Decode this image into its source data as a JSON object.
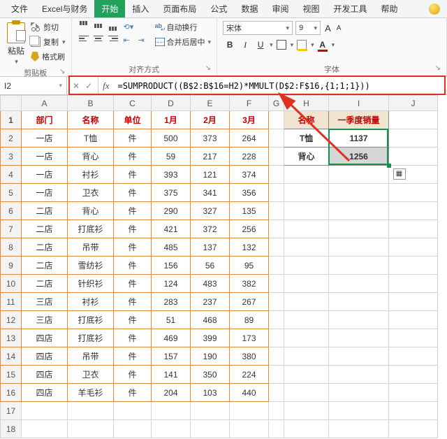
{
  "menu": {
    "items": [
      "文件",
      "Excel与财务",
      "开始",
      "插入",
      "页面布局",
      "公式",
      "数据",
      "审阅",
      "视图",
      "开发工具",
      "帮助"
    ],
    "active_index": 2
  },
  "ribbon": {
    "clipboard": {
      "paste": "粘贴",
      "cut": "剪切",
      "copy": "复制",
      "brush": "格式刷",
      "label": "剪贴板"
    },
    "align": {
      "wrap": "自动换行",
      "merge": "合并后居中",
      "label": "对齐方式"
    },
    "font": {
      "name": "宋体",
      "size": "9",
      "grow": "A",
      "shrink": "A",
      "bold": "B",
      "italic": "I",
      "underline": "U",
      "label": "字体"
    }
  },
  "namebox": "I2",
  "formula": "=SUMPRODUCT((B$2:B$16=H2)*MMULT(D$2:F$16,{1;1;1}))",
  "headers_main": [
    "部门",
    "名称",
    "单位",
    "1月",
    "2月",
    "3月"
  ],
  "headers_side": [
    "名称",
    "一季度销量"
  ],
  "rows": [
    [
      "一店",
      "T恤",
      "件",
      "500",
      "373",
      "264"
    ],
    [
      "一店",
      "背心",
      "件",
      "59",
      "217",
      "228"
    ],
    [
      "一店",
      "衬衫",
      "件",
      "393",
      "121",
      "374"
    ],
    [
      "一店",
      "卫衣",
      "件",
      "375",
      "341",
      "356"
    ],
    [
      "二店",
      "背心",
      "件",
      "290",
      "327",
      "135"
    ],
    [
      "二店",
      "打底衫",
      "件",
      "421",
      "372",
      "256"
    ],
    [
      "二店",
      "吊带",
      "件",
      "485",
      "137",
      "132"
    ],
    [
      "二店",
      "雪纺衫",
      "件",
      "156",
      "56",
      "95"
    ],
    [
      "二店",
      "针织衫",
      "件",
      "124",
      "483",
      "382"
    ],
    [
      "三店",
      "衬衫",
      "件",
      "283",
      "237",
      "267"
    ],
    [
      "三店",
      "打底衫",
      "件",
      "51",
      "468",
      "89"
    ],
    [
      "四店",
      "打底衫",
      "件",
      "469",
      "399",
      "173"
    ],
    [
      "四店",
      "吊带",
      "件",
      "157",
      "190",
      "380"
    ],
    [
      "四店",
      "卫衣",
      "件",
      "141",
      "350",
      "224"
    ],
    [
      "四店",
      "羊毛衫",
      "件",
      "204",
      "103",
      "440"
    ]
  ],
  "side_rows": [
    [
      "T恤",
      "1137"
    ],
    [
      "背心",
      "1256"
    ]
  ],
  "col_letters": [
    "A",
    "B",
    "C",
    "D",
    "E",
    "F",
    "G",
    "H",
    "I",
    "J"
  ]
}
